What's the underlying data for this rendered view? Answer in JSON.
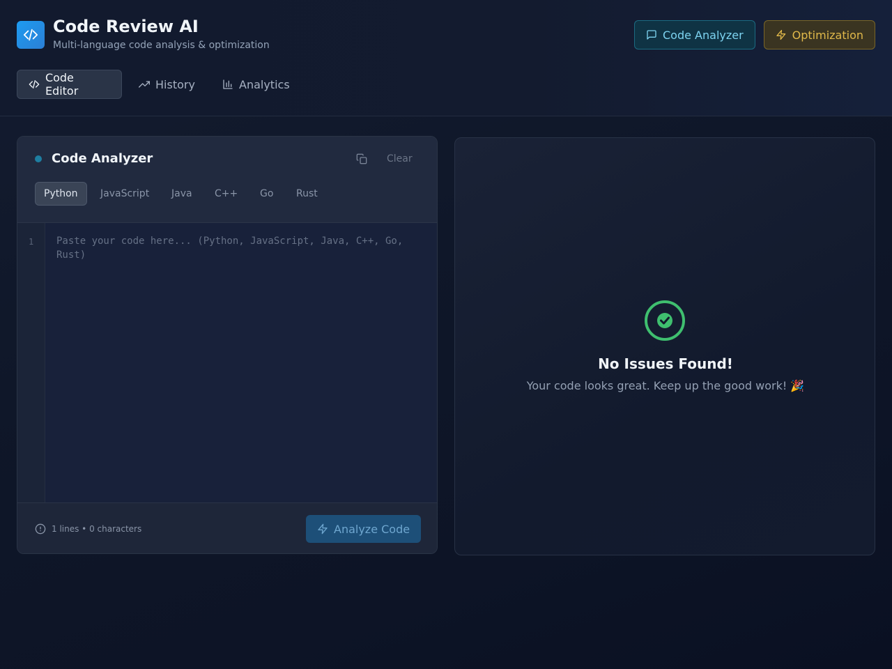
{
  "header": {
    "title": "Code Review AI",
    "subtitle": "Multi-language code analysis & optimization",
    "buttons": [
      {
        "label": "Code Analyzer",
        "icon": "message-square-icon",
        "color": "#7dd3f0"
      },
      {
        "label": "Optimization",
        "icon": "zap-icon",
        "color": "#e0b84a"
      }
    ]
  },
  "tabs": [
    {
      "label": "Code Editor",
      "icon": "code-icon",
      "active": true
    },
    {
      "label": "History",
      "icon": "trending-up-icon",
      "active": false
    },
    {
      "label": "Analytics",
      "icon": "bar-chart-icon",
      "active": false
    }
  ],
  "editor": {
    "title": "Code Analyzer",
    "clear_label": "Clear",
    "languages": [
      "Python",
      "JavaScript",
      "Java",
      "C++",
      "Go",
      "Rust"
    ],
    "selected_language": "Python",
    "line_number": "1",
    "placeholder": "Paste your code here... (Python, JavaScript, Java, C++, Go, Rust)",
    "stats": "1 lines • 0 characters",
    "analyze_label": "Analyze Code"
  },
  "results": {
    "title": "No Issues Found!",
    "message": "Your code looks great. Keep up the good work! 🎉",
    "status_color": "#3fbf6f"
  }
}
